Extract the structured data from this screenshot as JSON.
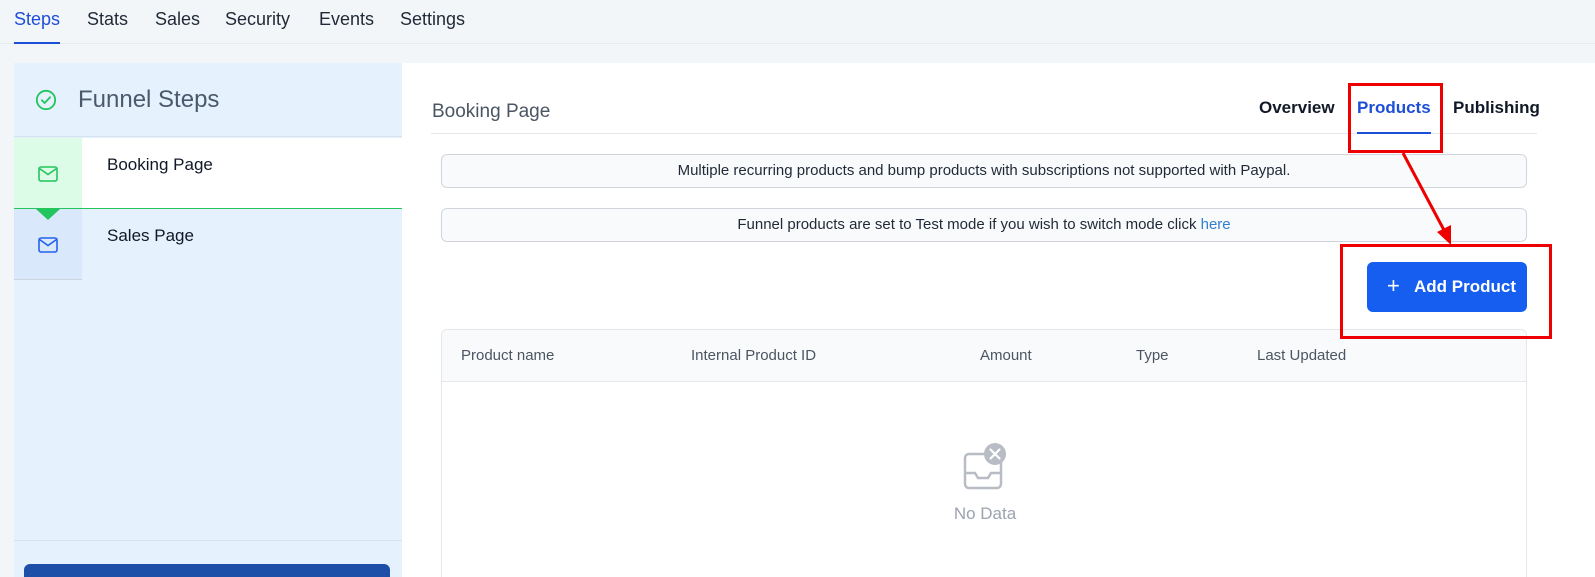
{
  "top_nav": {
    "tabs": [
      {
        "label": "Steps",
        "active": true
      },
      {
        "label": "Stats",
        "active": false
      },
      {
        "label": "Sales",
        "active": false
      },
      {
        "label": "Security",
        "active": false
      },
      {
        "label": "Events",
        "active": false
      },
      {
        "label": "Settings",
        "active": false
      }
    ]
  },
  "sidebar": {
    "title": "Funnel Steps",
    "title_icon": "check-circle-icon",
    "steps": [
      {
        "label": "Booking Page",
        "icon": "mail-icon",
        "active": true
      },
      {
        "label": "Sales Page",
        "icon": "mail-icon",
        "active": false
      }
    ]
  },
  "main": {
    "page_title": "Booking Page",
    "subtabs": [
      {
        "label": "Overview",
        "active": false
      },
      {
        "label": "Products",
        "active": true
      },
      {
        "label": "Publishing",
        "active": false
      }
    ],
    "notices": {
      "paypal": "Multiple recurring products and bump products with subscriptions not supported with Paypal.",
      "test_mode_prefix": "Funnel products are set to Test mode if you wish to switch mode click",
      "test_mode_link": "here"
    },
    "add_product_button": {
      "icon": "plus-icon",
      "label": "Add Product"
    },
    "table": {
      "columns": [
        "Product name",
        "Internal Product ID",
        "Amount",
        "Type",
        "Last Updated"
      ],
      "rows": [],
      "empty_icon": "empty-inbox-icon",
      "empty_text": "No Data"
    }
  },
  "colors": {
    "accent": "#1d4ed8",
    "button": "#155eef",
    "success": "#22c55e",
    "sidebar_bg": "#e5f1fd",
    "annotation": "#ef0000"
  }
}
